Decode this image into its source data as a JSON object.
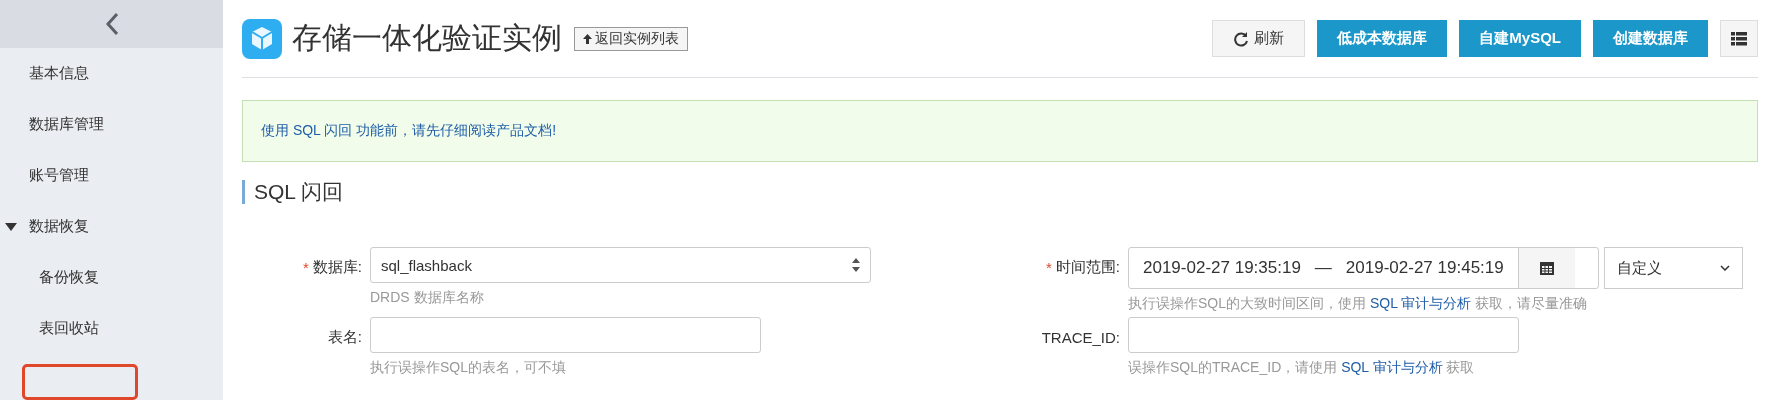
{
  "sidebar": {
    "items": [
      {
        "label": "基本信息",
        "kind": "item"
      },
      {
        "label": "数据库管理",
        "kind": "item"
      },
      {
        "label": "账号管理",
        "kind": "item"
      },
      {
        "label": "数据恢复",
        "kind": "group",
        "expanded": true,
        "children": [
          {
            "label": "备份恢复"
          },
          {
            "label": "表回收站"
          }
        ]
      }
    ]
  },
  "header": {
    "title": "存储一体化验证实例",
    "back_link": "返回实例列表",
    "buttons": [
      {
        "label": "刷新",
        "kind": "default"
      },
      {
        "label": "低成本数据库",
        "kind": "primary"
      },
      {
        "label": "自建MySQL",
        "kind": "primary"
      },
      {
        "label": "创建数据库",
        "kind": "primary"
      },
      {
        "kind": "list"
      }
    ]
  },
  "alert": {
    "text": "使用 SQL 闪回 功能前，请先仔细阅读产品文档!"
  },
  "section": {
    "title": "SQL 闪回"
  },
  "form": {
    "fields": [
      {
        "required_mark": "*",
        "label": "数据库:",
        "kind": "select",
        "value": "sql_flashback",
        "help": {
          "text": "DRDS 数据库名称"
        }
      },
      {
        "required_mark": "*",
        "label": "时间范围:",
        "kind": "daterange",
        "start": "2019-02-27 19:35:19",
        "separator": "—",
        "end": "2019-02-27 19:45:19",
        "preset": "自定义",
        "help": {
          "text": "执行误操作SQL的大致时间区间，使用 ",
          "link": "SQL 审计与分析",
          "after": " 获取，请尽量准确"
        }
      },
      {
        "label": "表名:",
        "kind": "text",
        "help": {
          "text": "执行误操作SQL的表名，可不填"
        }
      },
      {
        "label": "TRACE_ID:",
        "kind": "text",
        "help": {
          "text": "误操作SQL的TRACE_ID，请使用 ",
          "link": "SQL 审计与分析",
          "after": " 获取"
        }
      }
    ]
  }
}
